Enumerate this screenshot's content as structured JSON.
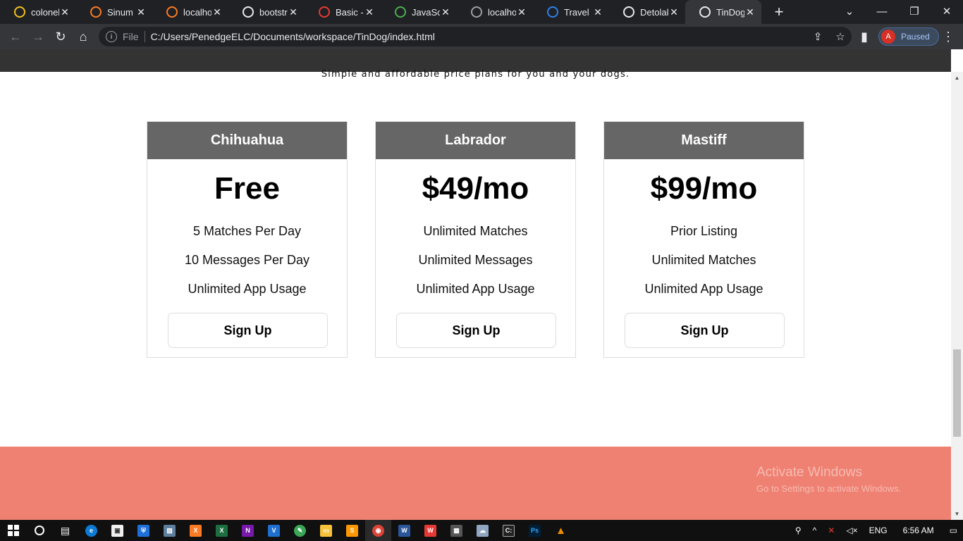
{
  "browser": {
    "tabs": [
      {
        "title": "coloneli",
        "icon": "github-icon",
        "color": "#f0c020"
      },
      {
        "title": "Sinum re",
        "icon": "xampp-icon",
        "color": "#fb7a24"
      },
      {
        "title": "localhos",
        "icon": "xampp-icon",
        "color": "#fb7a24"
      },
      {
        "title": "bootstra",
        "icon": "globe-icon",
        "color": "#e8eaed"
      },
      {
        "title": "Basic - S",
        "icon": "codepen-icon",
        "color": "#e53935"
      },
      {
        "title": "JavaScri",
        "icon": "w3schools-icon",
        "color": "#4caf50"
      },
      {
        "title": "localhos",
        "icon": "globe-icon",
        "color": "#9aa0a6"
      },
      {
        "title": "Travel",
        "icon": "travel-icon",
        "color": "#2f80ed"
      },
      {
        "title": "Detolak",
        "icon": "globe-icon",
        "color": "#e8eaed"
      },
      {
        "title": "TinDog",
        "icon": "globe-icon",
        "color": "#e8eaed",
        "active": true
      }
    ],
    "address": {
      "scheme_label": "File",
      "url": "C:/Users/PenedgeELC/Documents/workspace/TinDog/index.html"
    },
    "profile": {
      "initial": "A",
      "status": "Paused"
    }
  },
  "page": {
    "tagline": "Simple and affordable price plans for you and your dogs.",
    "plans": [
      {
        "name": "Chihuahua",
        "price": "Free",
        "features": [
          "5 Matches Per Day",
          "10 Messages Per Day",
          "Unlimited App Usage"
        ],
        "cta": "Sign Up"
      },
      {
        "name": "Labrador",
        "price": "$49/mo",
        "features": [
          "Unlimited Matches",
          "Unlimited Messages",
          "Unlimited App Usage"
        ],
        "cta": "Sign Up"
      },
      {
        "name": "Mastiff",
        "price": "$99/mo",
        "features": [
          "Prior Listing",
          "Unlimited Matches",
          "Unlimited App Usage"
        ],
        "cta": "Sign Up"
      }
    ],
    "footer_color": "#ef8172",
    "header_color": "#666666"
  },
  "watermark": {
    "line1": "Activate Windows",
    "line2": "Go to Settings to activate Windows."
  },
  "taskbar": {
    "language": "ENG",
    "time": "6:56 AM"
  }
}
